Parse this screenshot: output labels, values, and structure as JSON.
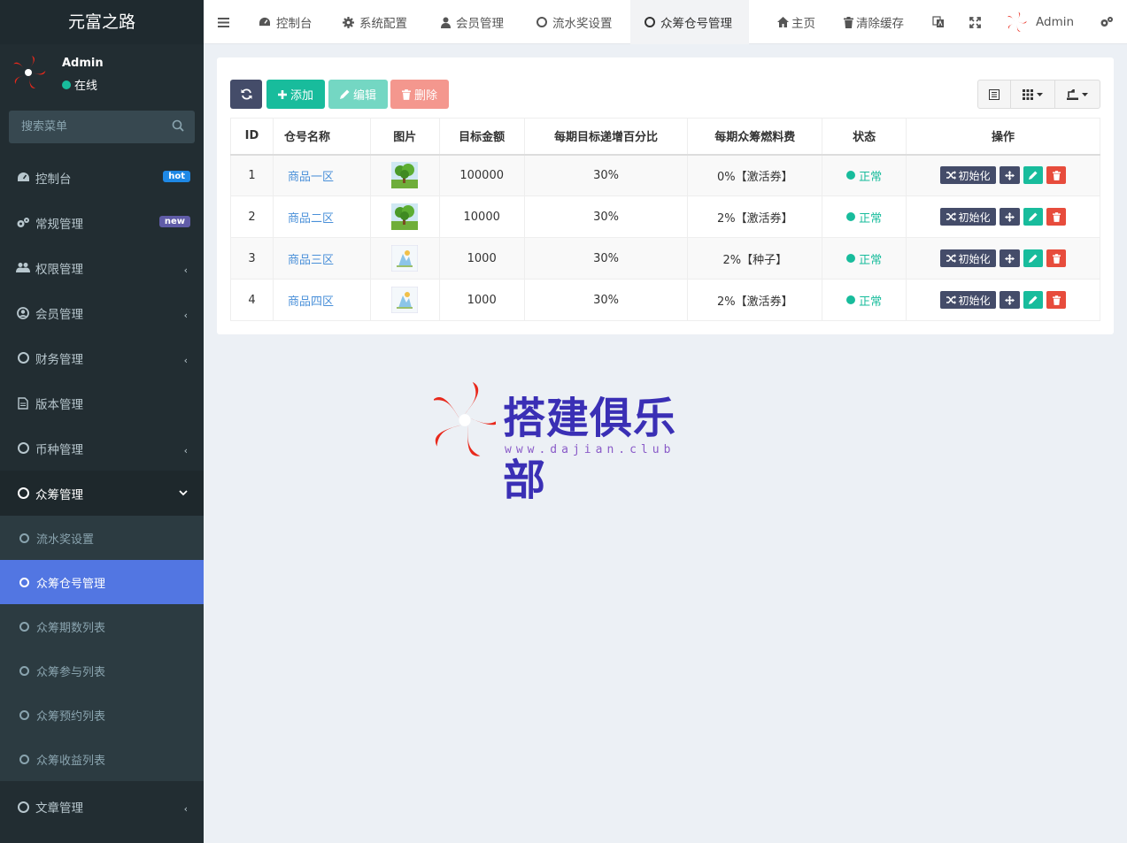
{
  "app": {
    "title": "元富之路"
  },
  "user": {
    "name": "Admin",
    "status": "在线"
  },
  "search": {
    "placeholder": "搜索菜单"
  },
  "menu": [
    {
      "label": "控制台",
      "badge": "hot"
    },
    {
      "label": "常规管理",
      "badge": "new"
    },
    {
      "label": "权限管理"
    },
    {
      "label": "会员管理"
    },
    {
      "label": "财务管理"
    },
    {
      "label": "版本管理"
    },
    {
      "label": "币种管理"
    },
    {
      "label": "众筹管理"
    },
    {
      "label": "文章管理"
    }
  ],
  "submenu": [
    {
      "label": "流水奖设置"
    },
    {
      "label": "众筹仓号管理"
    },
    {
      "label": "众筹期数列表"
    },
    {
      "label": "众筹参与列表"
    },
    {
      "label": "众筹预约列表"
    },
    {
      "label": "众筹收益列表"
    }
  ],
  "tabs": [
    {
      "label": "控制台"
    },
    {
      "label": "系统配置"
    },
    {
      "label": "会员管理"
    },
    {
      "label": "流水奖设置"
    },
    {
      "label": "众筹仓号管理"
    }
  ],
  "topnav": {
    "home": "主页",
    "clear_cache": "清除缓存",
    "admin": "Admin"
  },
  "toolbar": {
    "add": "添加",
    "edit": "编辑",
    "delete": "删除"
  },
  "table": {
    "headers": [
      "ID",
      "仓号名称",
      "图片",
      "目标金额",
      "每期目标递增百分比",
      "每期众筹燃料费",
      "状态",
      "操作"
    ],
    "rows": [
      {
        "id": "1",
        "name": "商品一区",
        "image": "tree",
        "target": "100000",
        "increase": "30%",
        "fee": "0%【激活券】",
        "status": "正常"
      },
      {
        "id": "2",
        "name": "商品二区",
        "image": "tree",
        "target": "10000",
        "increase": "30%",
        "fee": "2%【激活券】",
        "status": "正常"
      },
      {
        "id": "3",
        "name": "商品三区",
        "image": "sketch",
        "target": "1000",
        "increase": "30%",
        "fee": "2%【种子】",
        "status": "正常"
      },
      {
        "id": "4",
        "name": "商品四区",
        "image": "sketch",
        "target": "1000",
        "increase": "30%",
        "fee": "2%【激活券】",
        "status": "正常"
      }
    ],
    "op_init": "初始化"
  },
  "watermark": {
    "title": "搭建俱乐部",
    "url": "www.dajian.club"
  },
  "colors": {
    "sidebar": "#222d32",
    "accent": "#18bc9c",
    "active": "#5276e2",
    "danger": "#e74c3c",
    "dark_btn": "#444c69"
  }
}
